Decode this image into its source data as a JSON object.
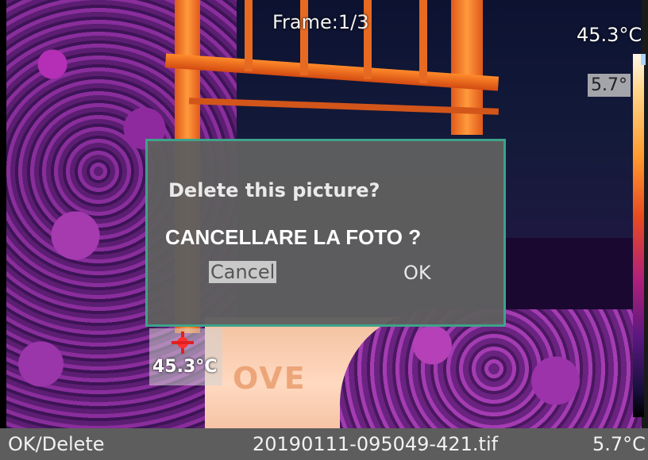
{
  "overlay": {
    "frame_label": "Frame:1/3",
    "max_temp": "45.3°C",
    "min_temp": "5.7°",
    "spot_temp": "45.3°C"
  },
  "dialog": {
    "title": "Delete this picture?",
    "caption": "CANCELLARE LA FOTO ?",
    "cancel_label": "Cancel",
    "ok_label": "OK"
  },
  "statusbar": {
    "action_hint": "OK/Delete",
    "filename": "20190111-095049-421.tif",
    "min_temp": "5.7°C"
  },
  "scene_text": "OVE"
}
